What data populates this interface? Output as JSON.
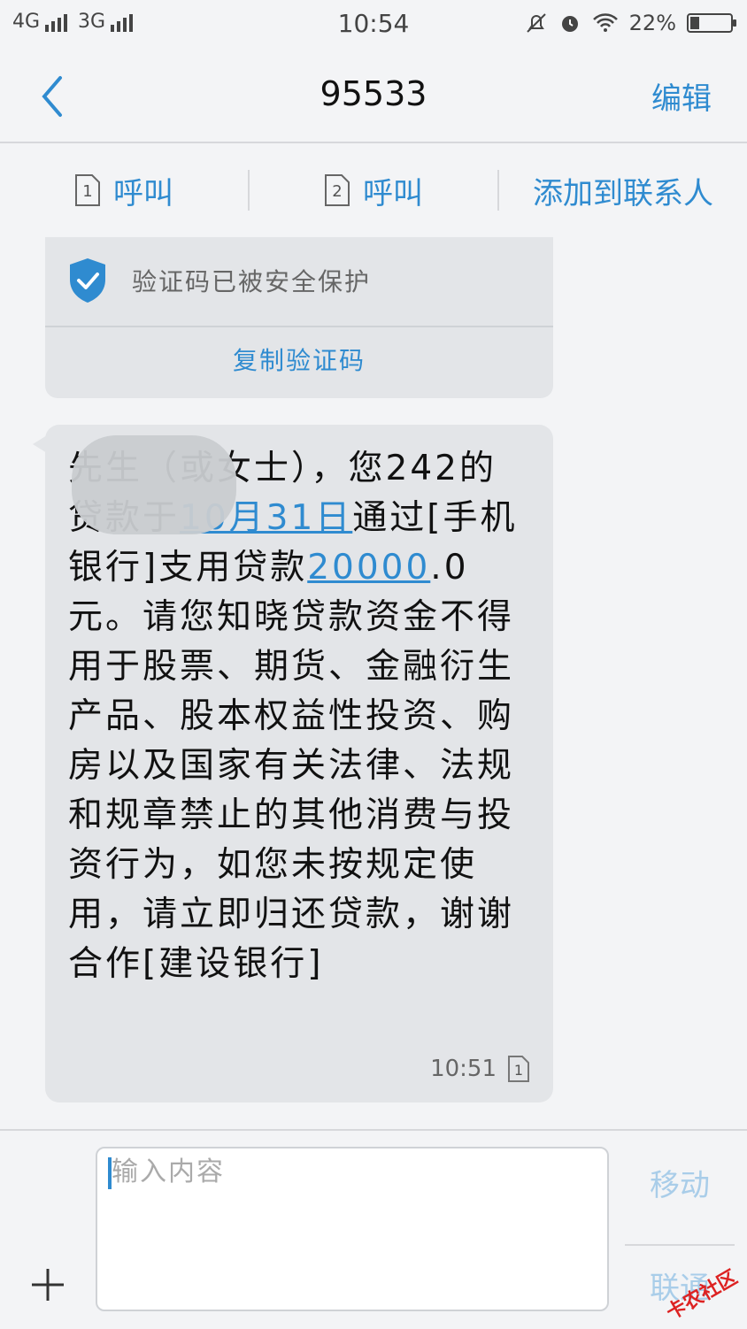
{
  "status": {
    "net1": "4G",
    "net2": "3G",
    "time": "10:54",
    "battery": "22%",
    "battery_level": 0.22
  },
  "header": {
    "title": "95533",
    "edit_label": "编辑"
  },
  "actions": [
    {
      "sim": "1",
      "label": "呼叫"
    },
    {
      "sim": "2",
      "label": "呼叫"
    },
    {
      "label": "添加到联系人"
    }
  ],
  "card": {
    "protect_text": "验证码已被安全保护",
    "copy_label": "复制验证码"
  },
  "message": {
    "p1": "先生（或女士），您",
    "p2": "242的贷款于",
    "date_link": "10月31日",
    "p3": "通过[手机银行]支用贷款",
    "amount_link": "20000",
    "p4": ".0元。请您知晓贷款资金不得用于股票、期货、金融衍生产品、股本权益性投资、购房以及国家有关法律、法规和规章禁止的其他消费与投资行为，如您未按规定使用，请立即归还贷款，谢谢合作[建设银行]",
    "time": "10:51",
    "sim": "1"
  },
  "input": {
    "placeholder": "输入内容",
    "move_label": "移动",
    "send_label": "联通"
  },
  "watermark": "卡农社区",
  "colors": {
    "accent": "#2f8bd0",
    "shield": "#2f8bd0",
    "bubble": "#e3e5e8"
  }
}
